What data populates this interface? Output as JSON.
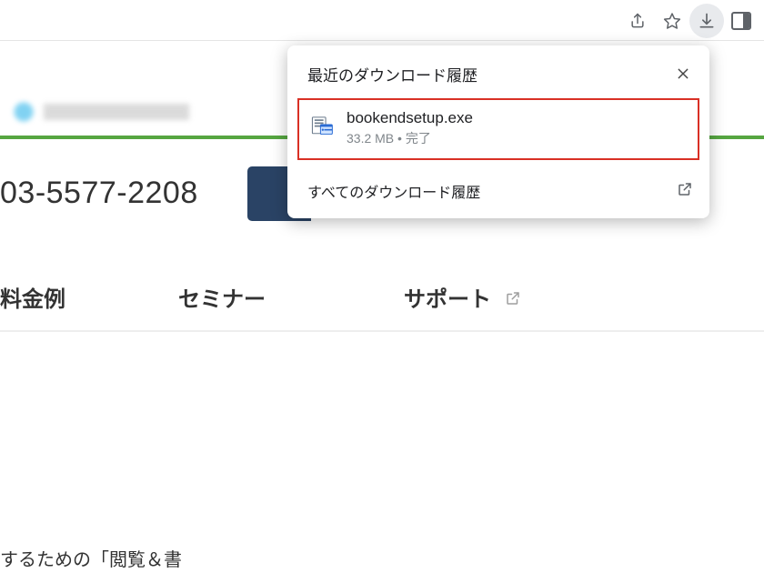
{
  "downloads_popup": {
    "title": "最近のダウンロード履歴",
    "item": {
      "filename": "bookendsetup.exe",
      "size": "33.2 MB",
      "status": "完了"
    },
    "all_text": "すべてのダウンロード履歴"
  },
  "page": {
    "phone": "03-5577-2208",
    "nav_pricing": "料金例",
    "nav_seminar": "セミナー",
    "nav_support": "サポート",
    "body_snippet": "するための「閲覧＆書"
  }
}
